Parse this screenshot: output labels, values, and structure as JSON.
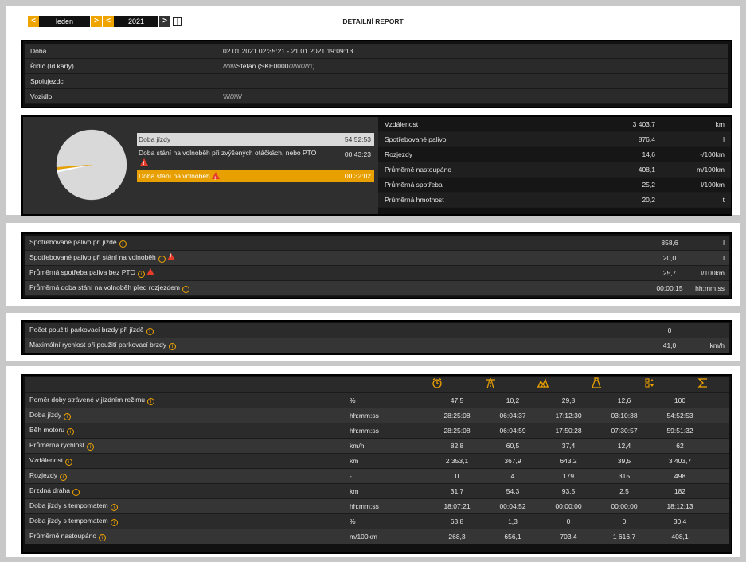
{
  "nav": {
    "month": "leden",
    "year": "2021",
    "prev": "<",
    "next": ">"
  },
  "title": "DETAILNÍ REPORT",
  "info": [
    {
      "k": "Doba",
      "v": "02.01.2021 02:35:21 - 21.01.2021 19:09:13"
    },
    {
      "k": "Řidič (Id karty)",
      "v": "Stefan (SKE0000"
    },
    {
      "k": "Spolujezdci",
      "v": ""
    },
    {
      "k": "Vozidlo",
      "v": ""
    }
  ],
  "pie": {
    "legend": [
      {
        "label": "Doba jízdy",
        "value": "54:52:53"
      },
      {
        "label": "Doba stání na volnoběh při zvýšených otáčkách, nebo PTO",
        "value": "00:43:23"
      },
      {
        "label": "Doba stání na volnoběh",
        "value": "00:32:02"
      }
    ],
    "shares": [
      96.1,
      1.3,
      1.0
    ]
  },
  "stats": [
    {
      "k": "Vzdálenost",
      "n": "3 403,7",
      "u": "km"
    },
    {
      "k": "Spotřebované palivo",
      "n": "876,4",
      "u": "l"
    },
    {
      "k": "Rozjezdy",
      "n": "14,6",
      "u": "-/100km"
    },
    {
      "k": "Průměrně nastoupáno",
      "n": "408,1",
      "u": "m/100km"
    },
    {
      "k": "Průměrná spotřeba",
      "n": "25,2",
      "u": "l/100km"
    },
    {
      "k": "Průměrná hmotnost",
      "n": "20,2",
      "u": "t"
    }
  ],
  "fuel": [
    {
      "k": "Spotřebované palivo při jízdě",
      "n": "858,6",
      "u": "l"
    },
    {
      "k": "Spotřebované palivo při stání na volnoběh",
      "n": "20,0",
      "u": "l"
    },
    {
      "k": "Průměrná spotřeba paliva bez PTO",
      "n": "25,7",
      "u": "l/100km"
    },
    {
      "k": "Průměrná doba stání na volnoběh před rozjezdem",
      "n": "00:00:15",
      "u": "hh:mm:ss"
    }
  ],
  "brake": [
    {
      "k": "Počet použití parkovací brzdy při jízdě",
      "n": "0",
      "u": ""
    },
    {
      "k": "Maximální rychlost při použití parkovací brzdy",
      "n": "41,0",
      "u": "km/h"
    }
  ],
  "table": {
    "icons": [
      "clock-icon",
      "highway-icon",
      "rural-road-icon",
      "city-icon",
      "maneuver-icon",
      "sum-icon"
    ],
    "rows": [
      {
        "k": "Poměr doby strávené v jízdním režimu",
        "u": "%",
        "c": [
          "47,5",
          "10,2",
          "29,8",
          "12,6",
          "100"
        ]
      },
      {
        "k": "Doba jízdy",
        "u": "hh:mm:ss",
        "c": [
          "28:25:08",
          "06:04:37",
          "17:12:30",
          "03:10:38",
          "54:52:53"
        ]
      },
      {
        "k": "Běh motoru",
        "u": "hh:mm:ss",
        "c": [
          "28:25:08",
          "06:04:59",
          "17:50:28",
          "07:30:57",
          "59:51:32"
        ]
      },
      {
        "k": "Průměrná rychlost",
        "u": "km/h",
        "c": [
          "82,8",
          "60,5",
          "37,4",
          "12,4",
          "62"
        ]
      },
      {
        "k": "Vzdálenost",
        "u": "km",
        "c": [
          "2 353,1",
          "367,9",
          "643,2",
          "39,5",
          "3 403,7"
        ]
      },
      {
        "k": "Rozjezdy",
        "u": "-",
        "c": [
          "0",
          "4",
          "179",
          "315",
          "498"
        ]
      },
      {
        "k": "Brzdná dráha",
        "u": "km",
        "c": [
          "31,7",
          "54,3",
          "93,5",
          "2,5",
          "182"
        ]
      },
      {
        "k": "Doba jízdy s tempomatem",
        "u": "hh:mm:ss",
        "c": [
          "18:07:21",
          "00:04:52",
          "00:00:00",
          "00:00:00",
          "18:12:13"
        ]
      },
      {
        "k": "Doba jízdy s tempomatem",
        "u": "%",
        "c": [
          "63,8",
          "1,3",
          "0",
          "0",
          "30,4"
        ]
      },
      {
        "k": "Průměrně nastoupáno",
        "u": "m/100km",
        "c": [
          "268,3",
          "656,1",
          "703,4",
          "1 616,7",
          "408,1"
        ]
      }
    ]
  }
}
